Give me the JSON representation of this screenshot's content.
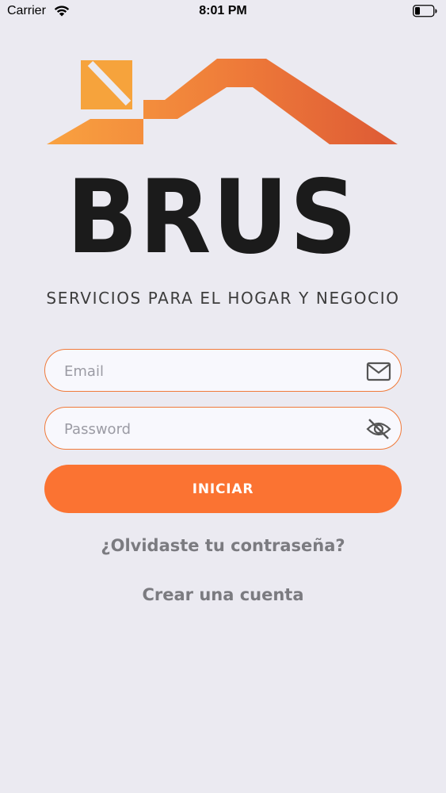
{
  "status_bar": {
    "carrier": "Carrier",
    "time": "8:01 PM"
  },
  "logo": {
    "brand": "BRUS",
    "tagline": "SERVICIOS PARA EL HOGAR Y NEGOCIO"
  },
  "form": {
    "email_placeholder": "Email",
    "password_placeholder": "Password",
    "submit_label": "INICIAR"
  },
  "links": {
    "forgot_password": "¿Olvidaste tu contraseña?",
    "create_account": "Crear una cuenta"
  },
  "colors": {
    "accent": "#fb7332",
    "background": "#ebeaf1",
    "field_border": "#f07a3a",
    "link": "#7b7b80"
  },
  "icons": {
    "email": "envelope-icon",
    "password": "eye-slash-icon"
  }
}
